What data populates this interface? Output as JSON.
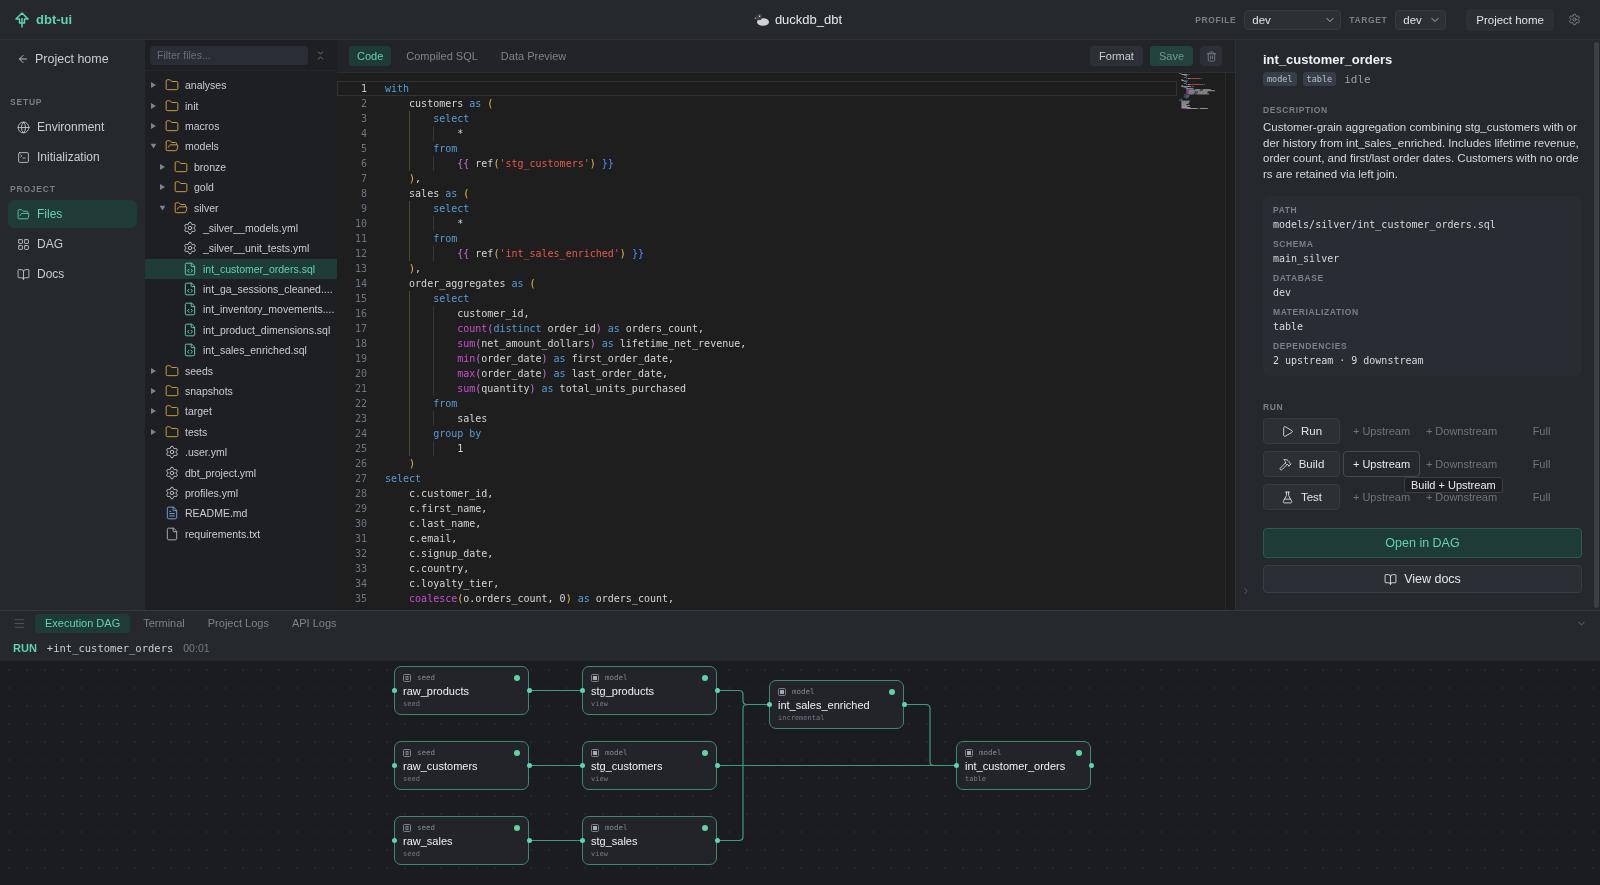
{
  "app": {
    "name": "dbt-ui"
  },
  "project": {
    "name": "duckdb_dbt"
  },
  "header": {
    "profile_label": "PROFILE",
    "profile": "dev",
    "target_label": "TARGET",
    "target": "dev",
    "home_button": "Project home"
  },
  "sidebar": {
    "back_link": "Project home",
    "sections": [
      {
        "title": "SETUP",
        "items": [
          {
            "label": "Environment",
            "selected": false
          },
          {
            "label": "Initialization",
            "selected": false
          }
        ]
      },
      {
        "title": "PROJECT",
        "items": [
          {
            "label": "Files",
            "selected": true
          },
          {
            "label": "DAG",
            "selected": false
          },
          {
            "label": "Docs",
            "selected": false
          }
        ]
      }
    ]
  },
  "file_tree": {
    "filter_placeholder": "Filter files...",
    "items": [
      {
        "kind": "folder",
        "name": "analyses",
        "expanded": false,
        "selected": false
      },
      {
        "kind": "folder",
        "name": "init",
        "expanded": false,
        "selected": false
      },
      {
        "kind": "folder",
        "name": "macros",
        "expanded": false,
        "selected": false
      },
      {
        "kind": "folder",
        "name": "models",
        "expanded": true,
        "selected": false,
        "children": [
          {
            "kind": "folder",
            "name": "bronze",
            "expanded": false,
            "selected": false
          },
          {
            "kind": "folder",
            "name": "gold",
            "expanded": false,
            "selected": false
          },
          {
            "kind": "folder",
            "name": "silver",
            "expanded": true,
            "selected": false,
            "children": [
              {
                "kind": "config",
                "name": "_silver__models.yml",
                "selected": false
              },
              {
                "kind": "config",
                "name": "_silver__unit_tests.yml",
                "selected": false
              },
              {
                "kind": "sql",
                "name": "int_customer_orders.sql",
                "selected": true
              },
              {
                "kind": "sql",
                "name": "int_ga_sessions_cleaned....",
                "selected": false
              },
              {
                "kind": "sql",
                "name": "int_inventory_movements....",
                "selected": false
              },
              {
                "kind": "sql",
                "name": "int_product_dimensions.sql",
                "selected": false
              },
              {
                "kind": "sql",
                "name": "int_sales_enriched.sql",
                "selected": false
              }
            ]
          }
        ]
      },
      {
        "kind": "folder",
        "name": "seeds",
        "expanded": false,
        "selected": false
      },
      {
        "kind": "folder",
        "name": "snapshots",
        "expanded": false,
        "selected": false
      },
      {
        "kind": "folder",
        "name": "target",
        "expanded": false,
        "selected": false
      },
      {
        "kind": "folder",
        "name": "tests",
        "expanded": false,
        "selected": false
      },
      {
        "kind": "config",
        "name": ".user.yml",
        "selected": false
      },
      {
        "kind": "config",
        "name": "dbt_project.yml",
        "selected": false
      },
      {
        "kind": "config",
        "name": "profiles.yml",
        "selected": false
      },
      {
        "kind": "markdown",
        "name": "README.md",
        "selected": false
      },
      {
        "kind": "text",
        "name": "requirements.txt",
        "selected": false
      }
    ]
  },
  "editor": {
    "tabs": [
      {
        "label": "Code",
        "selected": true
      },
      {
        "label": "Compiled SQL",
        "selected": false
      },
      {
        "label": "Data Preview",
        "selected": false
      }
    ],
    "actions": [
      {
        "kind": "secondary",
        "label": "Format",
        "disabled": false
      },
      {
        "kind": "primary",
        "label": "Save",
        "disabled": true
      }
    ],
    "lines": [
      {
        "number": "1",
        "active": true,
        "tokens": [
          {
            "kind": "keyword",
            "text": "with"
          }
        ]
      },
      {
        "number": "2",
        "active": false,
        "tokens": [
          {
            "kind": "plain",
            "text": "    customers"
          },
          {
            "kind": "keyword",
            "text": " as"
          },
          {
            "kind": "bracket1",
            "text": " ("
          }
        ]
      },
      {
        "number": "3",
        "active": false,
        "tokens": [
          {
            "kind": "keyword",
            "text": "        select"
          }
        ]
      },
      {
        "number": "4",
        "active": false,
        "tokens": [
          {
            "kind": "plain",
            "text": "            *"
          }
        ]
      },
      {
        "number": "5",
        "active": false,
        "tokens": [
          {
            "kind": "keyword",
            "text": "        from"
          }
        ]
      },
      {
        "number": "6",
        "active": false,
        "tokens": [
          {
            "kind": "bracket2",
            "text": "            {{"
          },
          {
            "kind": "plain",
            "text": " ref"
          },
          {
            "kind": "bracket1",
            "text": "("
          },
          {
            "kind": "string",
            "text": "'stg_customers'"
          },
          {
            "kind": "bracket1",
            "text": ")"
          },
          {
            "kind": "bracket3",
            "text": " }}"
          }
        ]
      },
      {
        "number": "7",
        "active": false,
        "tokens": [
          {
            "kind": "bracket1",
            "text": "    )"
          },
          {
            "kind": "plain",
            "text": ","
          }
        ]
      },
      {
        "number": "8",
        "active": false,
        "tokens": [
          {
            "kind": "plain",
            "text": "    sales"
          },
          {
            "kind": "keyword",
            "text": " as"
          },
          {
            "kind": "bracket1",
            "text": " ("
          }
        ]
      },
      {
        "number": "9",
        "active": false,
        "tokens": [
          {
            "kind": "keyword",
            "text": "        select"
          }
        ]
      },
      {
        "number": "10",
        "active": false,
        "tokens": [
          {
            "kind": "plain",
            "text": "            *"
          }
        ]
      },
      {
        "number": "11",
        "active": false,
        "tokens": [
          {
            "kind": "keyword",
            "text": "        from"
          }
        ]
      },
      {
        "number": "12",
        "active": false,
        "tokens": [
          {
            "kind": "bracket2",
            "text": "            {{"
          },
          {
            "kind": "plain",
            "text": " ref"
          },
          {
            "kind": "bracket1",
            "text": "("
          },
          {
            "kind": "string",
            "text": "'int_sales_enriched'"
          },
          {
            "kind": "bracket1",
            "text": ")"
          },
          {
            "kind": "bracket3",
            "text": " }}"
          }
        ]
      },
      {
        "number": "13",
        "active": false,
        "tokens": [
          {
            "kind": "bracket1",
            "text": "    )"
          },
          {
            "kind": "plain",
            "text": ","
          }
        ]
      },
      {
        "number": "14",
        "active": false,
        "tokens": [
          {
            "kind": "plain",
            "text": "    order_aggregates"
          },
          {
            "kind": "keyword",
            "text": " as"
          },
          {
            "kind": "bracket1",
            "text": " ("
          }
        ]
      },
      {
        "number": "15",
        "active": false,
        "tokens": [
          {
            "kind": "keyword",
            "text": "        select"
          }
        ]
      },
      {
        "number": "16",
        "active": false,
        "tokens": [
          {
            "kind": "plain",
            "text": "            customer_id,"
          }
        ]
      },
      {
        "number": "17",
        "active": false,
        "tokens": [
          {
            "kind": "function",
            "text": "            count"
          },
          {
            "kind": "bracket2",
            "text": "("
          },
          {
            "kind": "keyword",
            "text": "distinct"
          },
          {
            "kind": "plain",
            "text": " order_id"
          },
          {
            "kind": "bracket2",
            "text": ")"
          },
          {
            "kind": "keyword",
            "text": " as"
          },
          {
            "kind": "plain",
            "text": " orders_count,"
          }
        ]
      },
      {
        "number": "18",
        "active": false,
        "tokens": [
          {
            "kind": "function",
            "text": "            sum"
          },
          {
            "kind": "bracket2",
            "text": "("
          },
          {
            "kind": "plain",
            "text": "net_amount_dollars"
          },
          {
            "kind": "bracket2",
            "text": ")"
          },
          {
            "kind": "keyword",
            "text": " as"
          },
          {
            "kind": "plain",
            "text": " lifetime_net_revenue,"
          }
        ]
      },
      {
        "number": "19",
        "active": false,
        "tokens": [
          {
            "kind": "function",
            "text": "            min"
          },
          {
            "kind": "bracket2",
            "text": "("
          },
          {
            "kind": "plain",
            "text": "order_date"
          },
          {
            "kind": "bracket2",
            "text": ")"
          },
          {
            "kind": "keyword",
            "text": " as"
          },
          {
            "kind": "plain",
            "text": " first_order_date,"
          }
        ]
      },
      {
        "number": "20",
        "active": false,
        "tokens": [
          {
            "kind": "function",
            "text": "            max"
          },
          {
            "kind": "bracket2",
            "text": "("
          },
          {
            "kind": "plain",
            "text": "order_date"
          },
          {
            "kind": "bracket2",
            "text": ")"
          },
          {
            "kind": "keyword",
            "text": " as"
          },
          {
            "kind": "plain",
            "text": " last_order_date,"
          }
        ]
      },
      {
        "number": "21",
        "active": false,
        "tokens": [
          {
            "kind": "function",
            "text": "            sum"
          },
          {
            "kind": "bracket2",
            "text": "("
          },
          {
            "kind": "plain",
            "text": "quantity"
          },
          {
            "kind": "bracket2",
            "text": ")"
          },
          {
            "kind": "keyword",
            "text": " as"
          },
          {
            "kind": "plain",
            "text": " total_units_purchased"
          }
        ]
      },
      {
        "number": "22",
        "active": false,
        "tokens": [
          {
            "kind": "keyword",
            "text": "        from"
          }
        ]
      },
      {
        "number": "23",
        "active": false,
        "tokens": [
          {
            "kind": "plain",
            "text": "            sales"
          }
        ]
      },
      {
        "number": "24",
        "active": false,
        "tokens": [
          {
            "kind": "keyword",
            "text": "        group by"
          }
        ]
      },
      {
        "number": "25",
        "active": false,
        "tokens": [
          {
            "kind": "plain",
            "text": "            1"
          }
        ]
      },
      {
        "number": "26",
        "active": false,
        "tokens": [
          {
            "kind": "bracket1",
            "text": "    )"
          }
        ]
      },
      {
        "number": "27",
        "active": false,
        "tokens": [
          {
            "kind": "keyword",
            "text": "select"
          }
        ]
      },
      {
        "number": "28",
        "active": false,
        "tokens": [
          {
            "kind": "plain",
            "text": "    c.customer_id,"
          }
        ]
      },
      {
        "number": "29",
        "active": false,
        "tokens": [
          {
            "kind": "plain",
            "text": "    c.first_name,"
          }
        ]
      },
      {
        "number": "30",
        "active": false,
        "tokens": [
          {
            "kind": "plain",
            "text": "    c.last_name,"
          }
        ]
      },
      {
        "number": "31",
        "active": false,
        "tokens": [
          {
            "kind": "plain",
            "text": "    c.email,"
          }
        ]
      },
      {
        "number": "32",
        "active": false,
        "tokens": [
          {
            "kind": "plain",
            "text": "    c.signup_date,"
          }
        ]
      },
      {
        "number": "33",
        "active": false,
        "tokens": [
          {
            "kind": "plain",
            "text": "    c.country,"
          }
        ]
      },
      {
        "number": "34",
        "active": false,
        "tokens": [
          {
            "kind": "plain",
            "text": "    c.loyalty_tier,"
          }
        ]
      },
      {
        "number": "35",
        "active": false,
        "tokens": [
          {
            "kind": "function",
            "text": "    coalesce"
          },
          {
            "kind": "bracket1",
            "text": "("
          },
          {
            "kind": "plain",
            "text": "o.orders_count, 0"
          },
          {
            "kind": "bracket1",
            "text": ")"
          },
          {
            "kind": "keyword",
            "text": " as"
          },
          {
            "kind": "plain",
            "text": " orders_count,"
          }
        ]
      }
    ]
  },
  "details": {
    "title": "int_customer_orders",
    "tags": [
      "model",
      "table"
    ],
    "status": "idle",
    "description_label": "DESCRIPTION",
    "description": "Customer-grain aggregation combining stg_customers with order history from int_sales_enriched. Includes lifetime revenue, order count, and first/last order dates. Customers with no orders are retained via left join.",
    "properties": [
      {
        "label": "PATH",
        "value": "models/silver/int_customer_orders.sql"
      },
      {
        "label": "SCHEMA",
        "value": "main_silver"
      },
      {
        "label": "DATABASE",
        "value": "dev"
      },
      {
        "label": "MATERIALIZATION",
        "value": "table"
      },
      {
        "label": "DEPENDENCIES",
        "value": "2 upstream · 9 downstream"
      }
    ],
    "run_label": "RUN",
    "run_rows": [
      {
        "kind": "run",
        "label": "Run",
        "options": [
          {
            "label": "+ Upstream",
            "hovered": false
          },
          {
            "label": "+ Downstream",
            "hovered": false
          },
          {
            "label": "Full",
            "hovered": false
          }
        ]
      },
      {
        "kind": "build",
        "label": "Build",
        "options": [
          {
            "label": "+ Upstream",
            "hovered": true,
            "tooltip": "Build + Upstream"
          },
          {
            "label": "+ Downstream",
            "hovered": false
          },
          {
            "label": "Full",
            "hovered": false
          }
        ]
      },
      {
        "kind": "test",
        "label": "Test",
        "options": [
          {
            "label": "+ Upstream",
            "hovered": false
          },
          {
            "label": "+ Downstream",
            "hovered": false
          },
          {
            "label": "Full",
            "hovered": false
          }
        ]
      }
    ],
    "actions": [
      {
        "kind": "primary",
        "label": "Open in DAG"
      },
      {
        "kind": "secondary",
        "label": "View docs"
      }
    ]
  },
  "bottom_panel": {
    "tabs": [
      {
        "label": "Execution DAG",
        "selected": true
      },
      {
        "label": "Terminal",
        "selected": false
      },
      {
        "label": "Project Logs",
        "selected": false
      },
      {
        "label": "API Logs",
        "selected": false
      }
    ],
    "run": {
      "label": "RUN",
      "target": "+int_customer_orders",
      "elapsed": "00:01"
    },
    "dag": {
      "nodes": [
        {
          "kind": "seed",
          "type": "seed",
          "name": "raw_products",
          "materialization": "seed",
          "succeeded": true
        },
        {
          "kind": "model",
          "type": "model",
          "name": "stg_products",
          "materialization": "view",
          "succeeded": true
        },
        {
          "kind": "model",
          "type": "model",
          "name": "int_sales_enriched",
          "materialization": "incremental",
          "succeeded": true
        },
        {
          "kind": "seed",
          "type": "seed",
          "name": "raw_customers",
          "materialization": "seed",
          "succeeded": true
        },
        {
          "kind": "model",
          "type": "model",
          "name": "stg_customers",
          "materialization": "view",
          "succeeded": true
        },
        {
          "kind": "model",
          "type": "model",
          "name": "int_customer_orders",
          "materialization": "table",
          "succeeded": true
        },
        {
          "kind": "seed",
          "type": "seed",
          "name": "raw_sales",
          "materialization": "seed",
          "succeeded": true
        },
        {
          "kind": "model",
          "type": "model",
          "name": "stg_sales",
          "materialization": "view",
          "succeeded": true
        }
      ]
    }
  }
}
